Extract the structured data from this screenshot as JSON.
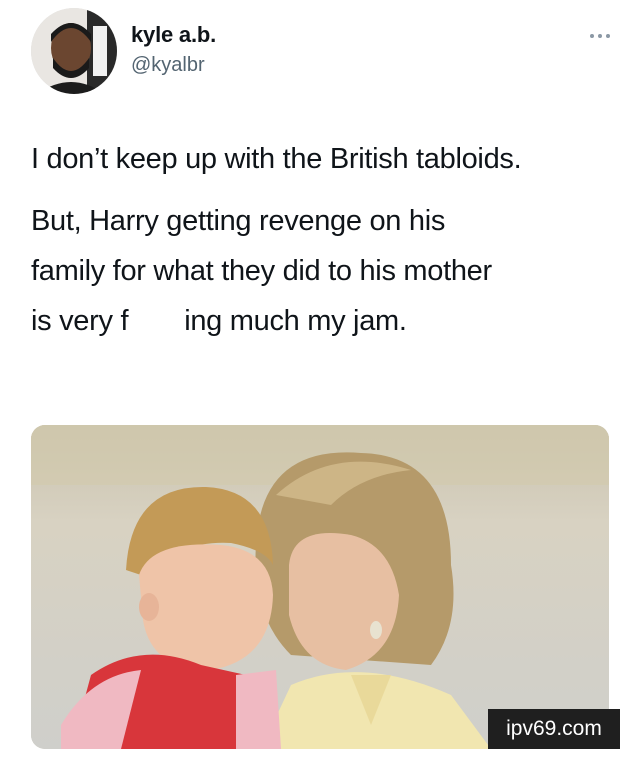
{
  "author": {
    "display_name": "kyle a.b.",
    "handle": "@kyalbr",
    "avatar_icon": "user-avatar"
  },
  "menu": {
    "icon": "more-horizontal-icon"
  },
  "tweet": {
    "paragraph_1": "I don’t keep up with the British tabloids.",
    "paragraph_2_line_1": "But, Harry getting revenge on his",
    "paragraph_2_line_2": "family for what they did to his mother",
    "paragraph_2_line_3a": "is very f",
    "paragraph_2_line_3b": "ing much my jam."
  },
  "watermark": {
    "text": "ipv69.com"
  },
  "colors": {
    "text_primary": "#0f1419",
    "text_secondary": "#536471",
    "background": "#ffffff"
  }
}
